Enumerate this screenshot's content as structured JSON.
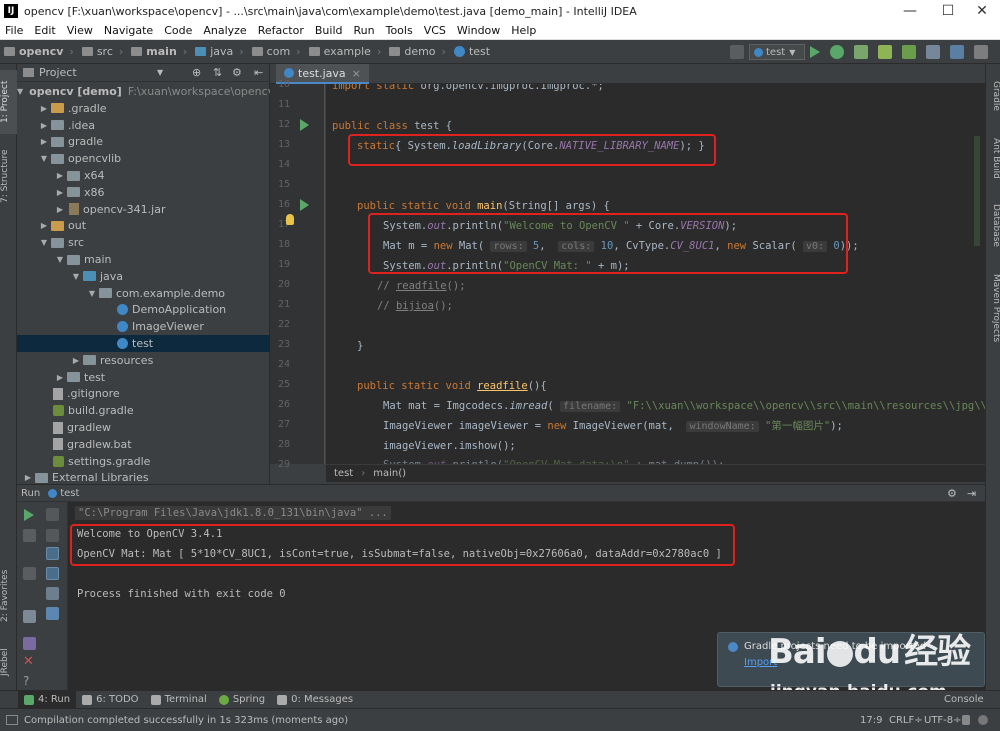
{
  "window": {
    "title": "opencv [F:\\xuan\\workspace\\opencv] - ...\\src\\main\\java\\com\\example\\demo\\test.java [demo_main] - IntelliJ IDEA",
    "icon_letter": "IJ",
    "controls": {
      "minimize": "—",
      "maximize": "☐",
      "close": "✕"
    }
  },
  "menu": [
    "File",
    "Edit",
    "View",
    "Navigate",
    "Code",
    "Analyze",
    "Refactor",
    "Build",
    "Run",
    "Tools",
    "VCS",
    "Window",
    "Help"
  ],
  "navbar": {
    "breadcrumbs": [
      "opencv",
      "src",
      "main",
      "java",
      "com",
      "example",
      "demo",
      "test"
    ],
    "run_config": "test"
  },
  "left_stripe": {
    "project_tab": "1: Project",
    "structure_tab": "7: Structure",
    "favorites_tab": "2: Favorites",
    "jrebel_tab": "JRebel"
  },
  "right_stripe": {
    "gradle": "Gradle",
    "ant": "Ant Build",
    "database": "Database",
    "maven": "Maven Projects"
  },
  "project_panel": {
    "header": "Project",
    "tree": [
      {
        "label": "opencv [demo]",
        "extra": "F:\\xuan\\workspace\\opencv",
        "depth": 0,
        "arrow": "▼",
        "icon": "folder-src",
        "bold": true
      },
      {
        "label": ".gradle",
        "depth": 1,
        "arrow": "▶",
        "icon": "folder-ex"
      },
      {
        "label": ".idea",
        "depth": 1,
        "arrow": "▶",
        "icon": "folder"
      },
      {
        "label": "gradle",
        "depth": 1,
        "arrow": "▶",
        "icon": "folder"
      },
      {
        "label": "opencvlib",
        "depth": 1,
        "arrow": "▼",
        "icon": "folder"
      },
      {
        "label": "x64",
        "depth": 2,
        "arrow": "▶",
        "icon": "folder"
      },
      {
        "label": "x86",
        "depth": 2,
        "arrow": "▶",
        "icon": "folder"
      },
      {
        "label": "opencv-341.jar",
        "depth": 2,
        "arrow": "▶",
        "icon": "jar"
      },
      {
        "label": "out",
        "depth": 1,
        "arrow": "▶",
        "icon": "folder-ex"
      },
      {
        "label": "src",
        "depth": 1,
        "arrow": "▼",
        "icon": "folder"
      },
      {
        "label": "main",
        "depth": 2,
        "arrow": "▼",
        "icon": "folder"
      },
      {
        "label": "java",
        "depth": 3,
        "arrow": "▼",
        "icon": "folder-src"
      },
      {
        "label": "com.example.demo",
        "depth": 4,
        "arrow": "▼",
        "icon": "folder"
      },
      {
        "label": "DemoApplication",
        "depth": 5,
        "arrow": "",
        "icon": "java"
      },
      {
        "label": "ImageViewer",
        "depth": 5,
        "arrow": "",
        "icon": "java"
      },
      {
        "label": "test",
        "depth": 5,
        "arrow": "",
        "icon": "java",
        "selected": true
      },
      {
        "label": "resources",
        "depth": 3,
        "arrow": "▶",
        "icon": "folder"
      },
      {
        "label": "test",
        "depth": 2,
        "arrow": "▶",
        "icon": "folder"
      },
      {
        "label": ".gitignore",
        "depth": 1,
        "arrow": "",
        "icon": "text"
      },
      {
        "label": "build.gradle",
        "depth": 1,
        "arrow": "",
        "icon": "gradle"
      },
      {
        "label": "gradlew",
        "depth": 1,
        "arrow": "",
        "icon": "text"
      },
      {
        "label": "gradlew.bat",
        "depth": 1,
        "arrow": "",
        "icon": "text"
      },
      {
        "label": "settings.gradle",
        "depth": 1,
        "arrow": "",
        "icon": "gradle"
      },
      {
        "label": "External Libraries",
        "depth": 0,
        "arrow": "▶",
        "icon": "folder"
      }
    ]
  },
  "editor": {
    "tab": "test.java",
    "line_numbers": [
      "10",
      "11",
      "12",
      "13",
      "14",
      "15",
      "16",
      "17",
      "18",
      "19",
      "20",
      "21",
      "22",
      "23",
      "24",
      "25",
      "26",
      "27",
      "28",
      "29"
    ],
    "breadcrumb": [
      "test",
      "main()"
    ]
  },
  "run_panel": {
    "header_label": "Run",
    "header_config": "test",
    "console": [
      "\"C:\\Program Files\\Java\\jdk1.8.0_131\\bin\\java\" ...",
      "Welcome to OpenCV 3.4.1",
      "OpenCV Mat: Mat [ 5*10*CV_8UC1, isCont=true, isSubmat=false, nativeObj=0x27606a0, dataAddr=0x2780ac0 ]",
      "",
      "Process finished with exit code 0"
    ],
    "notification": {
      "title": "Gradle projects need to be imported",
      "link": "Import"
    }
  },
  "watermark": {
    "brand_lead": "Bai",
    "brand_tail": "du",
    "cn_text": "经验",
    "url": "jingyan.baidu.com"
  },
  "bottom_tabs": [
    {
      "label": "4: Run",
      "color": "#59a869",
      "active": true
    },
    {
      "label": "6: TODO",
      "color": "#aaaaaa"
    },
    {
      "label": "Terminal",
      "color": "#aaaaaa"
    },
    {
      "label": "Spring",
      "color": "#6cab42"
    },
    {
      "label": "0: Messages",
      "color": "#aaaaaa"
    }
  ],
  "bottom_right_tab": "Console",
  "status": {
    "message": "Compilation completed successfully in 1s 323ms (moments ago)",
    "position": "17:9",
    "line_sep": "CRLF÷",
    "encoding": "UTF-8÷"
  },
  "colors": {
    "highlight_box": "#e0221f",
    "accent": "#4a88c7",
    "editor_bg": "#2b2b2b"
  }
}
